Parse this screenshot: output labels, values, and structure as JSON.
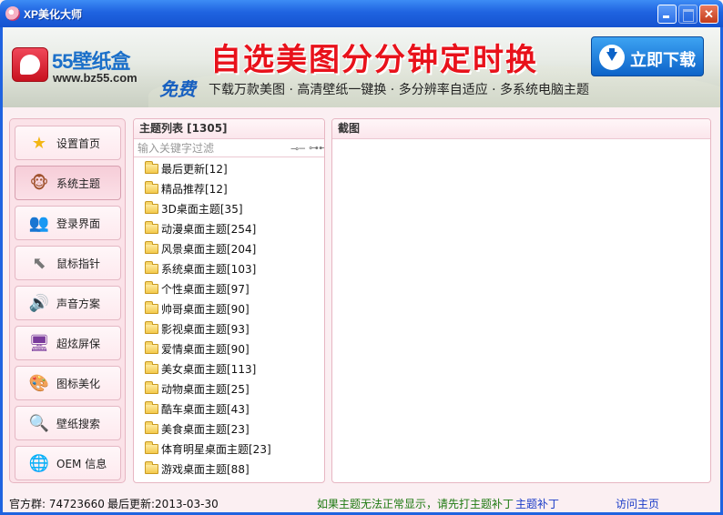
{
  "window": {
    "title": "XP美化大师",
    "controls": {
      "minimize": "",
      "maximize": "",
      "close": "✕"
    }
  },
  "banner": {
    "logo_text": "55壁纸盒",
    "logo_url": "www.bz55.com",
    "slogan": "自选美图分分钟定时换",
    "free_tag": "免费",
    "features": "下载万款美图 · 高清壁纸一键换 · 多分辨率自适应 · 多系统电脑主题",
    "download_button": "立即下载"
  },
  "sidebar": {
    "active_index": 1,
    "items": [
      {
        "label": "设置首页",
        "icon": "star-icon",
        "glyph": "★",
        "color": "#f3b614"
      },
      {
        "label": "系统主题",
        "icon": "monkey-face-icon",
        "glyph": "🐵",
        "color": "#a0522d"
      },
      {
        "label": "登录界面",
        "icon": "users-icon",
        "glyph": "👥",
        "color": "#c2548a"
      },
      {
        "label": "鼠标指针",
        "icon": "cursor-icon",
        "glyph": "⬉",
        "color": "#777777"
      },
      {
        "label": "声音方案",
        "icon": "speaker-icon",
        "glyph": "🔊",
        "color": "#777777"
      },
      {
        "label": "超炫屏保",
        "icon": "monitor-icon",
        "glyph": "🖥",
        "color": "#7a3b9c"
      },
      {
        "label": "图标美化",
        "icon": "palette-icon",
        "glyph": "🎨",
        "color": "#e07a2b"
      },
      {
        "label": "壁纸搜索",
        "icon": "magnifier-icon",
        "glyph": "🔍",
        "color": "#5b7fa8"
      },
      {
        "label": "OEM  信息",
        "icon": "globe-icon",
        "glyph": "🌐",
        "color": "#6a6fbf"
      }
    ]
  },
  "theme_list": {
    "title": "主题列表 [1305]",
    "filter_placeholder": "输入关键字过滤",
    "items": [
      "最后更新[12]",
      "精品推荐[12]",
      "3D桌面主题[35]",
      "动漫桌面主题[254]",
      "风景桌面主题[204]",
      "系统桌面主题[103]",
      "个性桌面主题[97]",
      "帅哥桌面主题[90]",
      "影视桌面主题[93]",
      "爱情桌面主题[90]",
      "美女桌面主题[113]",
      "动物桌面主题[25]",
      "酷车桌面主题[43]",
      "美食桌面主题[23]",
      "体育明星桌面主题[23]",
      "游戏桌面主题[88]"
    ]
  },
  "screenshot_panel": {
    "title": "截图"
  },
  "status": {
    "qq_group": "官方群: 74723660",
    "last_update": "最后更新:2013-03-30",
    "notice": "如果主题无法正常显示，请先打主题补丁",
    "patch_link": "主题补丁",
    "home_link": "访问主页"
  },
  "colors": {
    "titlebar": "#1f63e0",
    "panel_border": "#e7b6c2",
    "notice_green": "#1f7a12",
    "link_blue": "#1a3cc8",
    "slogan_red": "#e8121b"
  }
}
